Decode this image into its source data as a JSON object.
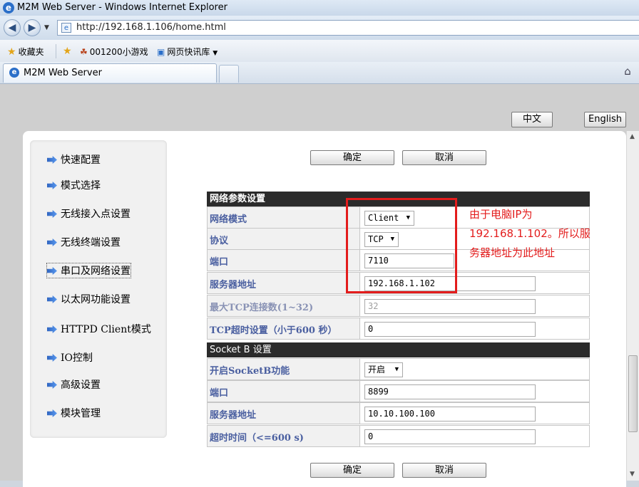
{
  "window": {
    "title": "M2M Web Server - Windows Internet Explorer"
  },
  "nav": {
    "url": "http://192.168.1.106/home.html"
  },
  "favorites": {
    "favorites_label": "收藏夹",
    "game_link": "001200小游戏",
    "news_link": "网页快讯库"
  },
  "tabs": [
    {
      "label": "M2M Web Server"
    }
  ],
  "lang": {
    "chinese": "中文",
    "english": "English"
  },
  "buttons": {
    "confirm": "确定",
    "cancel": "取消"
  },
  "sidebar": {
    "items": [
      {
        "label": "快速配置"
      },
      {
        "label": "模式选择"
      },
      {
        "label": "无线接入点设置"
      },
      {
        "label": "无线终端设置"
      },
      {
        "label": "串口及网络设置"
      },
      {
        "label": "以太网功能设置"
      },
      {
        "label": "HTTPD Client模式"
      },
      {
        "label": "IO控制"
      },
      {
        "label": "高级设置"
      },
      {
        "label": "模块管理"
      }
    ]
  },
  "network": {
    "title": "网络参数设置",
    "rows": [
      {
        "label": "网络模式",
        "value": "Client"
      },
      {
        "label": "协议",
        "value": "TCP"
      },
      {
        "label": "端口",
        "value": "7110"
      },
      {
        "label": "服务器地址",
        "value": "192.168.1.102"
      },
      {
        "label": "最大TCP连接数(1~32)",
        "value": "32"
      },
      {
        "label": "TCP超时设置（小于600 秒）",
        "value": "0"
      }
    ]
  },
  "socketb": {
    "title": "Socket B 设置",
    "rows": [
      {
        "label": "开启SocketB功能",
        "value": "开启"
      },
      {
        "label": "端口",
        "value": "8899"
      },
      {
        "label": "服务器地址",
        "value": "10.10.100.100"
      },
      {
        "label": "超时时间（<=600 s)",
        "value": "0"
      }
    ]
  },
  "annotation": {
    "text": "由于电脑IP为192.168.1.102。所以服务器地址为此地址"
  },
  "colors": {
    "annotation": "#e31c1c",
    "header_bg": "#2b2b2b",
    "label_text": "#4a5fa0"
  },
  "icons": {
    "browser": "ie-icon",
    "back": "back-icon",
    "forward": "forward-icon",
    "home": "home-icon",
    "menu_arrow": "arrow-right-icon"
  }
}
